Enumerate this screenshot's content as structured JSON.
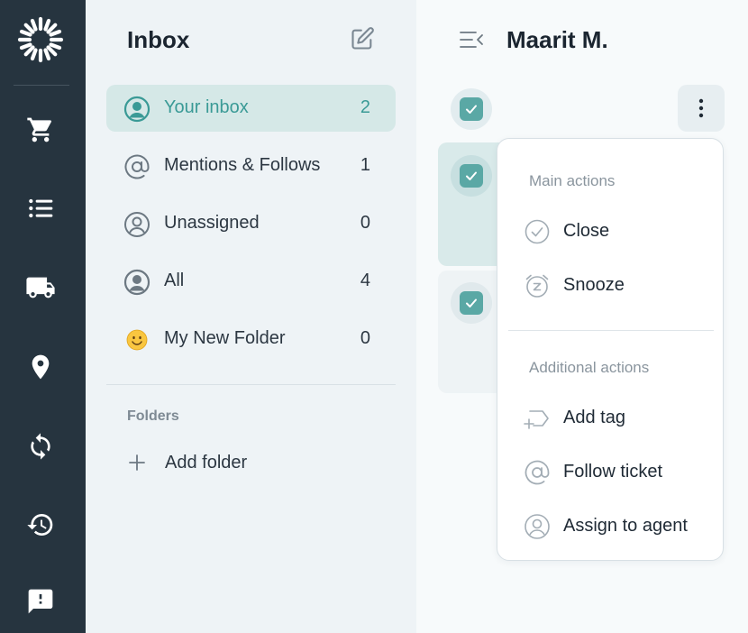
{
  "rail": {
    "icons": [
      "sunburst-logo-icon",
      "cart-icon",
      "list-icon",
      "truck-icon",
      "map-pin-icon",
      "sync-icon",
      "history-icon",
      "feedback-icon"
    ]
  },
  "folders": {
    "title": "Inbox",
    "items": [
      {
        "label": "Your inbox",
        "count": "2",
        "icon": "user-circle-icon",
        "active": true
      },
      {
        "label": "Mentions & Follows",
        "count": "1",
        "icon": "at-sign-icon"
      },
      {
        "label": "Unassigned",
        "count": "0",
        "icon": "user-circle-outline-icon"
      },
      {
        "label": "All",
        "count": "4",
        "icon": "user-circle-filled-icon"
      },
      {
        "label": "My New Folder",
        "count": "0",
        "icon": "smiley-emoji-icon"
      }
    ],
    "section_label": "Folders",
    "add_folder_label": "Add folder"
  },
  "main": {
    "contact_name": "Maarit M."
  },
  "menu": {
    "main_heading": "Main actions",
    "main_items": [
      {
        "label": "Close",
        "icon": "check-circle-icon"
      },
      {
        "label": "Snooze",
        "icon": "alarm-clock-icon"
      }
    ],
    "additional_heading": "Additional actions",
    "additional_items": [
      {
        "label": "Add tag",
        "icon": "add-tag-icon"
      },
      {
        "label": "Follow ticket",
        "icon": "at-sign-icon"
      },
      {
        "label": "Assign to agent",
        "icon": "user-circle-icon"
      }
    ]
  },
  "colors": {
    "rail_bg": "#26343f",
    "accent": "#5aa8a5",
    "active_bg": "#d5e8e7"
  }
}
